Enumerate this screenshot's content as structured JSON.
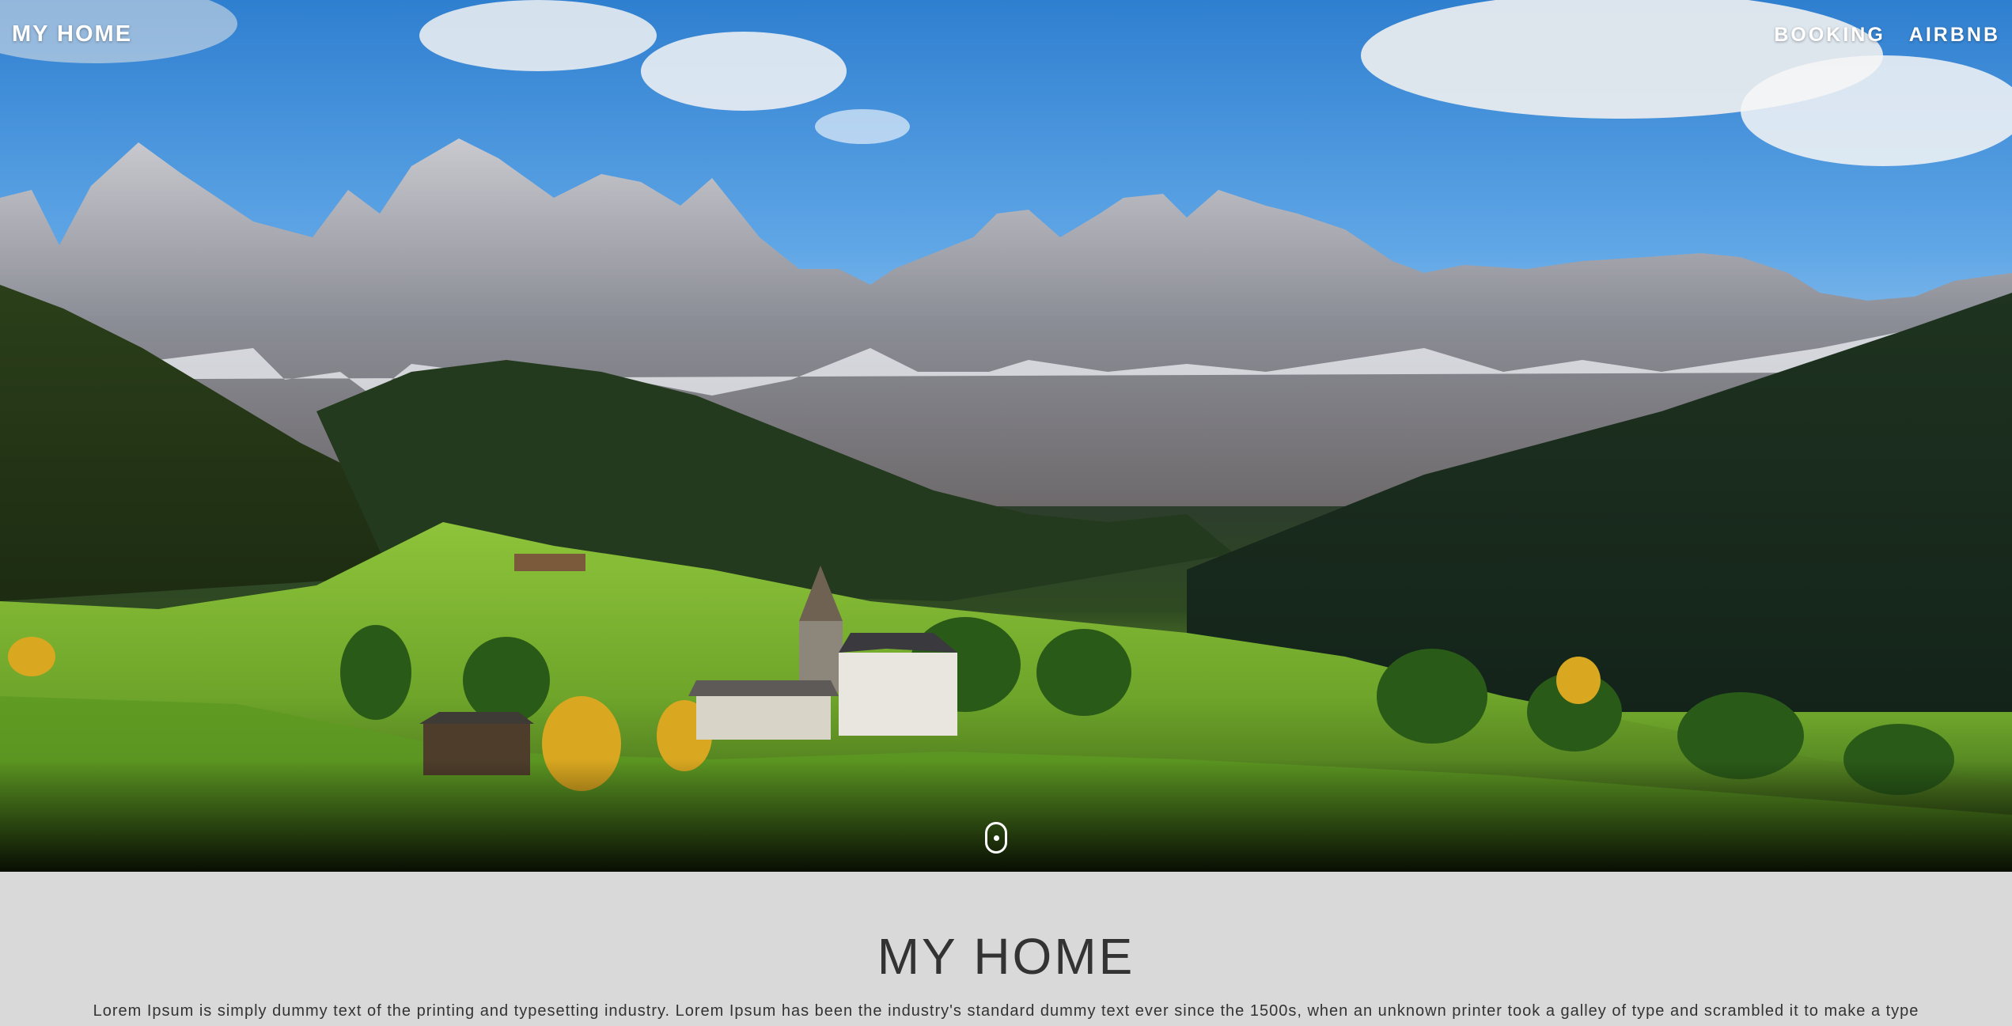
{
  "nav": {
    "brand": "MY HOME",
    "links": [
      {
        "label": "BOOKING"
      },
      {
        "label": "AIRBNB"
      }
    ]
  },
  "hero": {
    "image_alt": "Mountain village landscape with church and alpine peaks",
    "scroll_icon": "mouse-scroll-icon"
  },
  "section": {
    "title": "MY HOME",
    "text": "Lorem Ipsum is simply dummy text of the printing and typesetting industry. Lorem Ipsum has been the industry's standard dummy text ever since the 1500s, when an unknown printer took a galley of type and scrambled it to make a type specimen book."
  },
  "colors": {
    "nav_text": "#ffffff",
    "section_bg": "#d9d9d9",
    "section_text": "#333333"
  }
}
